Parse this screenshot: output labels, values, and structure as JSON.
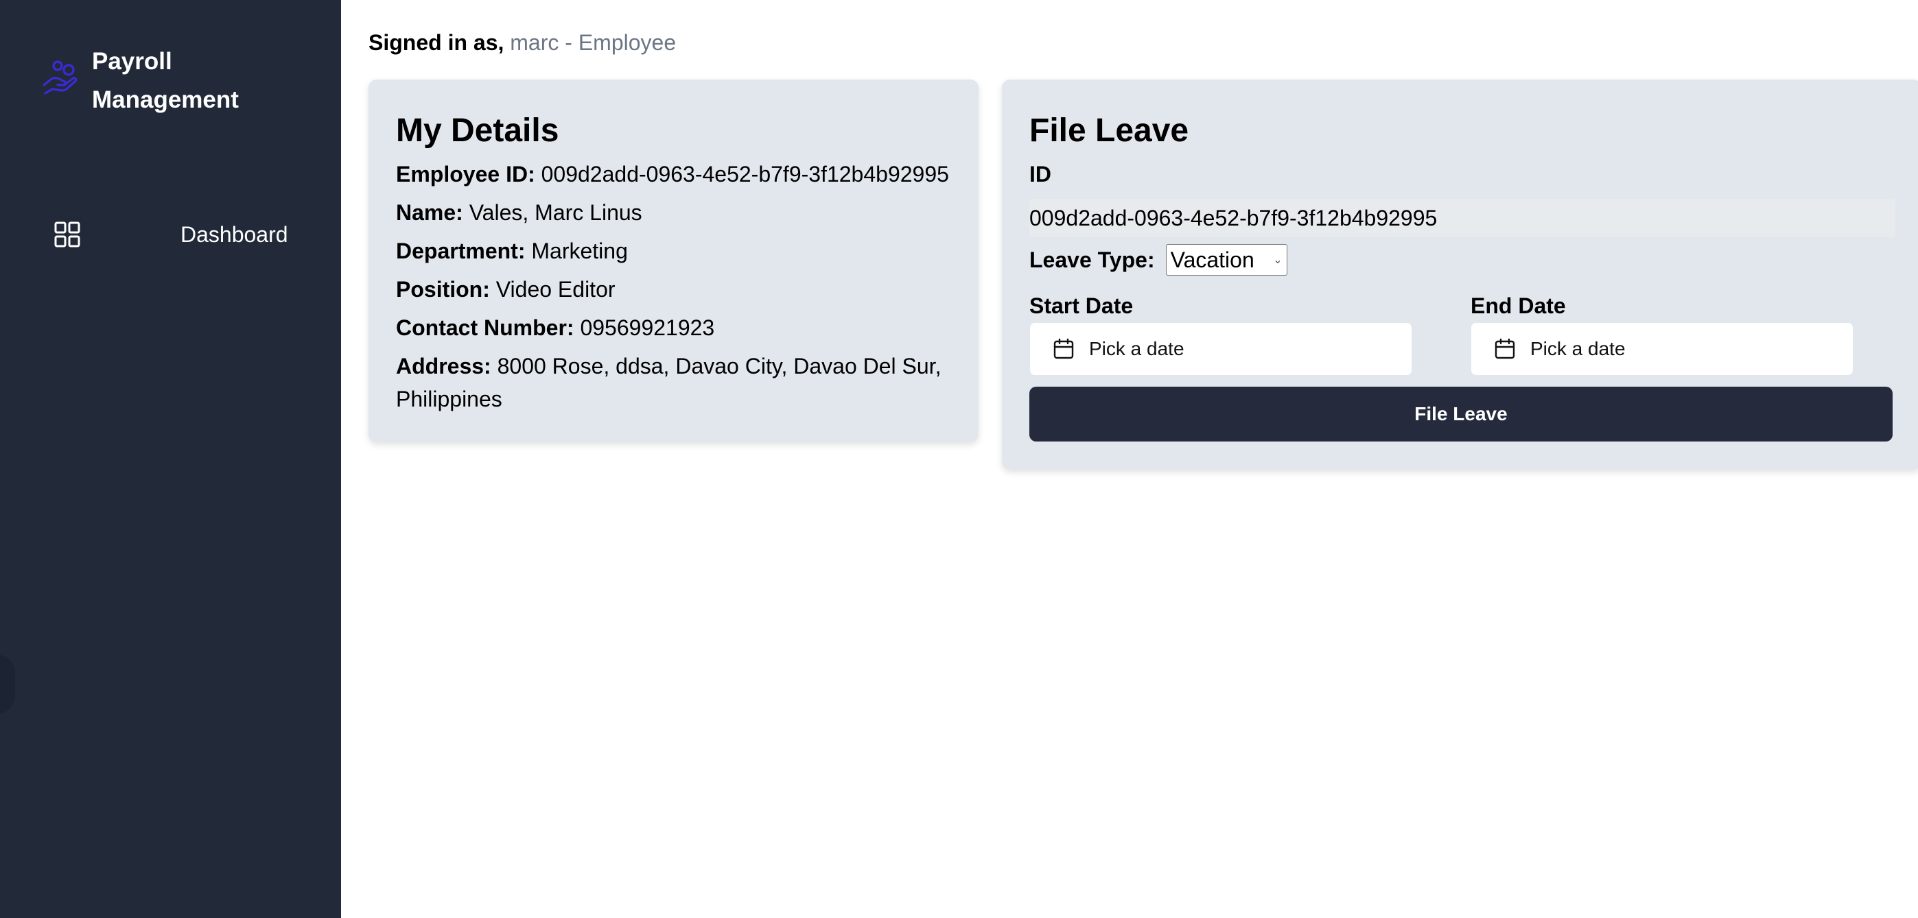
{
  "sidebar": {
    "brand_line1": "Payroll",
    "brand_line2": "Management",
    "nav": [
      {
        "label": "Dashboard",
        "icon": "grid-icon"
      }
    ],
    "accent_color": "#3a2bd8",
    "background": "#222a3a"
  },
  "header": {
    "signed_in_prefix": "Signed in as,",
    "user": "marc - Employee"
  },
  "details": {
    "title": "My Details",
    "rows": [
      {
        "label": "Employee ID:",
        "value": "009d2add-0963-4e52-b7f9-3f12b4b92995"
      },
      {
        "label": "Name:",
        "value": "Vales, Marc Linus"
      },
      {
        "label": "Department:",
        "value": "Marketing"
      },
      {
        "label": "Position:",
        "value": "Video Editor"
      },
      {
        "label": "Contact Number:",
        "value": "09569921923"
      },
      {
        "label": "Address:",
        "value": "8000 Rose, ddsa, Davao City, Davao Del Sur, Philippines"
      }
    ]
  },
  "leave": {
    "title": "File Leave",
    "id_label": "ID",
    "id_value": "009d2add-0963-4e52-b7f9-3f12b4b92995",
    "leave_type_label": "Leave Type:",
    "leave_type_selected": "Vacation",
    "start_label": "Start Date",
    "start_placeholder": "Pick a date",
    "end_label": "End Date",
    "end_placeholder": "Pick a date",
    "submit_label": "File Leave",
    "button_color": "#252b3c"
  }
}
